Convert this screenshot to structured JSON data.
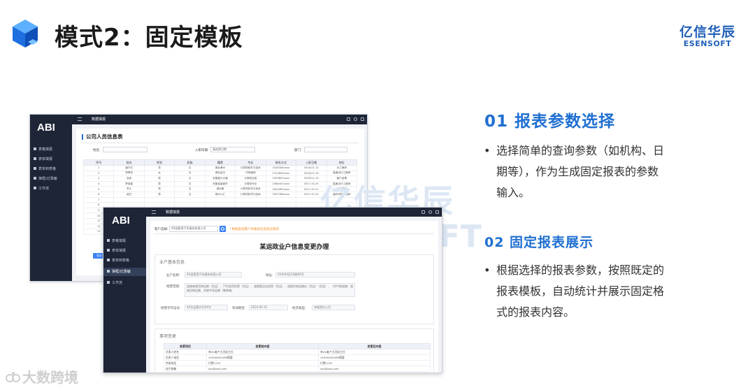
{
  "slide": {
    "title": "模式2：固定模板",
    "brand_cn": "亿信华辰",
    "brand_en": "ESENSOFT",
    "watermark_cn": "亿信华辰",
    "watermark_en": "ESENSOFT",
    "footer_text": "大数跨境",
    "accent_color": "#1f6fd1"
  },
  "sections": [
    {
      "heading": "01  报表参数选择",
      "lines": [
        "选择简单的查询参数（如机构、日",
        "期等），作为生成固定报表的参数",
        "输入。"
      ]
    },
    {
      "heading": "02  固定报表展示",
      "lines": [
        "根据选择的报表参数，按照既定的",
        "报表模板，自动统计并展示固定格",
        "式的报表内容。"
      ]
    }
  ],
  "app1": {
    "logo": "ABI",
    "topbar_title": "数据填报",
    "nav": [
      "表格填报",
      "表单填报",
      "表单到表格",
      "弹框/记录编",
      "工作流"
    ],
    "page_title": "公司人员信息表",
    "filter_name_label": "姓名:",
    "filter_date_label": "入职日期:",
    "filter_date_value": "请选择日期",
    "filter_dept_label": "部门:",
    "columns": [
      "序号",
      "姓名",
      "性别",
      "民族",
      "籍贯",
      "专业",
      "联系方式",
      "入职日期",
      "岗位"
    ],
    "rows": [
      [
        "1",
        "潘宁红",
        "男",
        "汉",
        "湖北黄州",
        "计算机软件与技术",
        "1528184xxxx",
        "2018-01-12",
        "长江海岸"
      ],
      [
        "2",
        "李晴杰",
        "女",
        "汉",
        "湖北武汉",
        "市场营销",
        "1312655xxxx",
        "2018-01-19",
        "高速出行工程师"
      ],
      [
        "3",
        "张尚",
        "男",
        "汉",
        "安徽嘉兴大通",
        "计算机应用",
        "1525652xxxx",
        "2018-01-19",
        "客户经理"
      ],
      [
        "4",
        "罗旭客",
        "男",
        "汉",
        "安徽省宣城市",
        "计算机专业",
        "1364401xxxx",
        "2017-10-25",
        "高速出行工程师"
      ],
      [
        "5",
        "李士",
        "男",
        "汉",
        "湖北黄",
        "计算机科学与技术",
        "1814062xxxx",
        "2017-10-11",
        "长江海岸"
      ],
      [
        "6",
        "吴白",
        "男",
        "汉",
        "费州六汇",
        "计算机科学与技术",
        "1907166xxxx",
        "2017-10-10",
        "高科学院工程师"
      ],
      [
        "7",
        "",
        "",
        "",
        "",
        "",
        "",
        "",
        ""
      ],
      [
        "8",
        "",
        "",
        "",
        "",
        "",
        "",
        "",
        ""
      ],
      [
        "9",
        "",
        "",
        "",
        "",
        "",
        "",
        "",
        ""
      ],
      [
        "10",
        "",
        "",
        "",
        "",
        "",
        "",
        "",
        ""
      ],
      [
        "11",
        "",
        "",
        "",
        "",
        "",
        "",
        "",
        ""
      ],
      [
        "12",
        "",
        "",
        "",
        "",
        "",
        "",
        "",
        ""
      ],
      [
        "13",
        "",
        "",
        "",
        "",
        "",
        "",
        "",
        ""
      ]
    ],
    "button": "导出"
  },
  "app2": {
    "logo": "ABI",
    "topbar_title": "数据填报",
    "nav": [
      "表格填报",
      "表单填报",
      "表单到表格",
      "弹框/记录编",
      "工作流"
    ],
    "search_label": "客户选择:",
    "search_value": "XX县租赁汽车服务有限公司",
    "note": "* 根据查询客户的报表信息变化情况",
    "report_title": "某运政业户信息变更办理",
    "basic_panel_title": "业户基本信息",
    "name_label": "业户名称:",
    "name_value": "XX县租赁汽车服务有限公司",
    "addr_label": "地址:",
    "addr_value": "XX市XX区XX路XX号",
    "scope_label": "经营范围:",
    "scope_value": "道路普通货物运输（货运）、汽车租赁经营（货运）、道路客运站经营（货运）、道路货物运输站（货运）（货运）、（涉中国道路）道路货物运输、货物专用运输（集装箱）",
    "license_label": "经营许可证号:",
    "license_value": "XX交运管许可XX字",
    "valid_label": "有效期至:",
    "valid_value": "2024-05-31",
    "status_label": "经济类型:",
    "status_value": "有限责任公司",
    "change_panel_title": "事项变更",
    "change_columns": [
      "变更项目",
      "变更前内容",
      "变更后内容"
    ],
    "change_rows": [
      [
        "负责人姓名",
        "李XX者户主活跃主任",
        "李XX者户主活跃主任"
      ],
      [
        "负责人电话",
        "1529XXX2289期要",
        "1529XXX2289期要"
      ],
      [
        "传真电话",
        "付费1233",
        "付费1233"
      ],
      [
        "电子邮箱",
        "xxx@xxx.com",
        "xxx@xxx.com"
      ]
    ]
  }
}
